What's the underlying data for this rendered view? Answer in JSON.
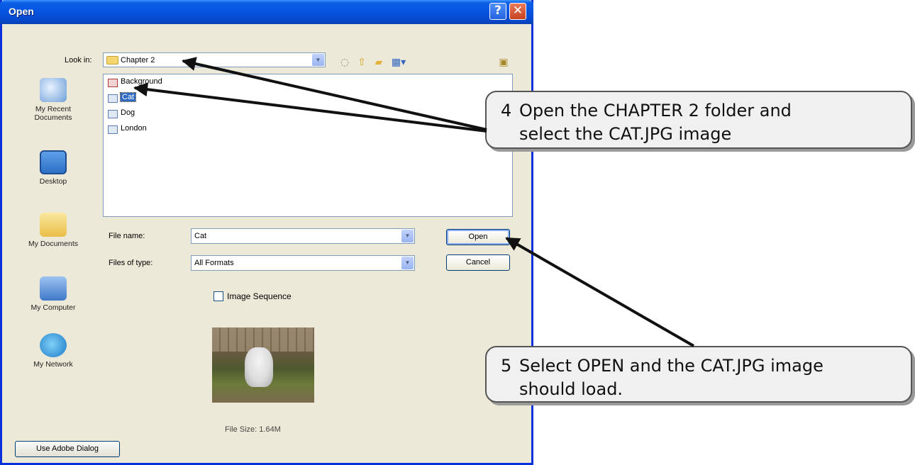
{
  "dialog": {
    "title": "Open",
    "help_glyph": "?",
    "close_glyph": "✕",
    "look_in_label": "Look in:",
    "look_in_value": "Chapter 2",
    "places": [
      {
        "label_line1": "My Recent",
        "label_line2": "Documents",
        "icon": "recent-documents-icon"
      },
      {
        "label_line1": "Desktop",
        "label_line2": "",
        "icon": "desktop-icon"
      },
      {
        "label_line1": "My Documents",
        "label_line2": "",
        "icon": "my-documents-icon"
      },
      {
        "label_line1": "My Computer",
        "label_line2": "",
        "icon": "my-computer-icon"
      },
      {
        "label_line1": "My Network",
        "label_line2": "",
        "icon": "my-network-icon"
      }
    ],
    "files": [
      {
        "name": "Background",
        "selected": false
      },
      {
        "name": "Cat",
        "selected": true
      },
      {
        "name": "Dog",
        "selected": false
      },
      {
        "name": "London",
        "selected": false
      }
    ],
    "file_name_label": "File name:",
    "file_name_value": "Cat",
    "files_of_type_label": "Files of type:",
    "files_of_type_value": "All Formats",
    "open_button": "Open",
    "cancel_button": "Cancel",
    "image_sequence_label": "Image Sequence",
    "file_size": "File Size: 1.64M",
    "adobe_dialog_button": "Use Adobe Dialog"
  },
  "callouts": [
    {
      "number": "4",
      "line1": "Open the CHAPTER 2 folder and",
      "line2": "select the CAT.JPG image"
    },
    {
      "number": "5",
      "line1": "Select OPEN and the CAT.JPG image",
      "line2": "should load."
    }
  ],
  "colors": {
    "titlebar": "#0553e0",
    "dialog_bg": "#ece9d8",
    "selection": "#316ac5",
    "callout_bg": "#f0f0f0"
  }
}
